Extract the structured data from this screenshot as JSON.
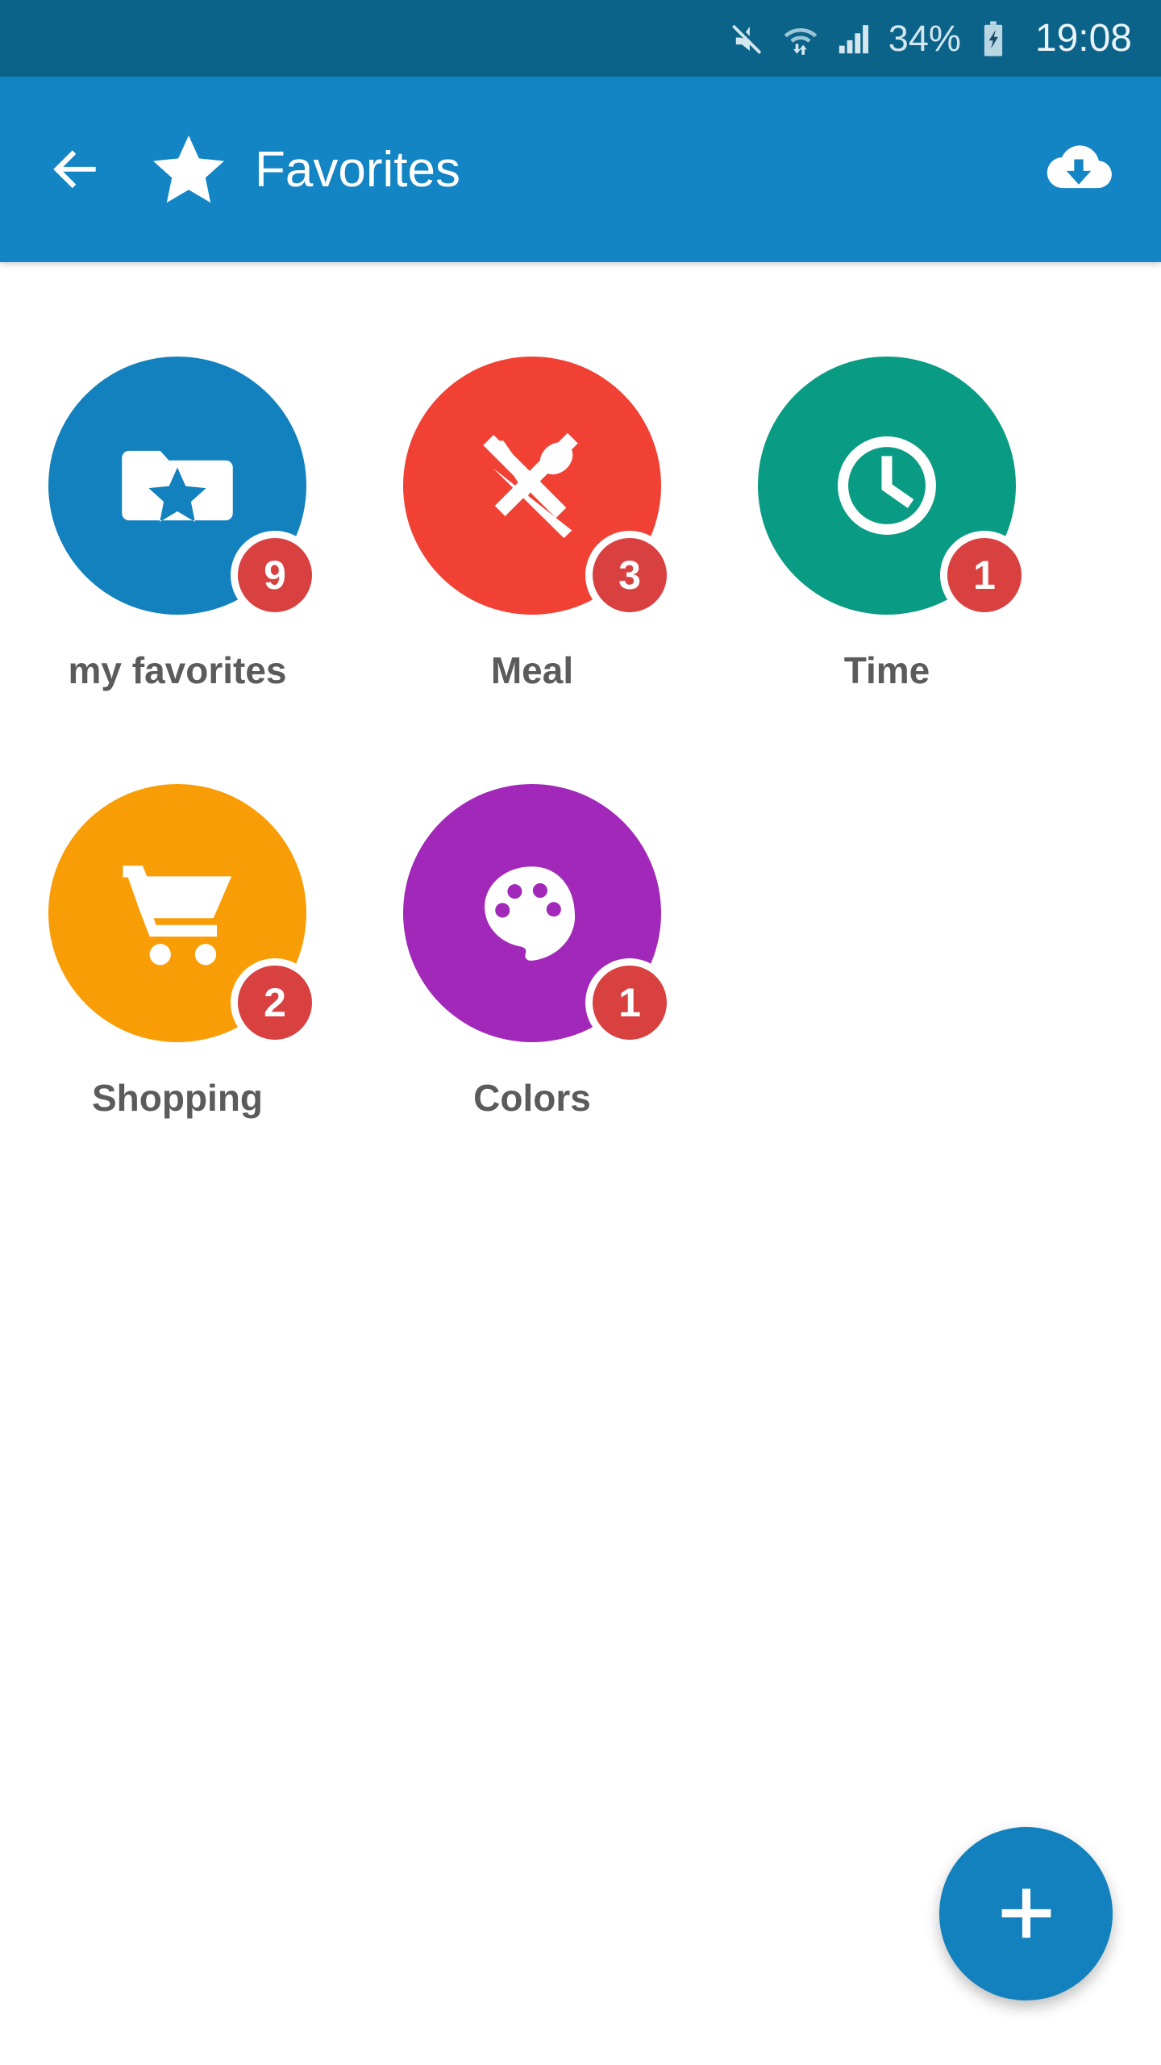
{
  "status_bar": {
    "mute_icon": "mute-icon",
    "wifi_icon": "wifi-transfer-icon",
    "signal_icon": "signal-bars-icon",
    "battery_percent": "34%",
    "battery_icon": "battery-charging-icon",
    "clock": "19:08",
    "background": "#0b6389",
    "foreground": "#d4e6ee"
  },
  "app_bar": {
    "back_icon": "back-arrow-icon",
    "brand_icon": "star-icon",
    "title": "Favorites",
    "action_icon": "cloud-download-icon",
    "background": "#1385c4",
    "foreground": "#ffffff"
  },
  "grid": {
    "items": [
      {
        "label": "my favorites",
        "badge": "9",
        "color": "#1281be",
        "icon": "folder-star-icon"
      },
      {
        "label": "Meal",
        "badge": "3",
        "color": "#f04134",
        "icon": "knife-spoon-icon"
      },
      {
        "label": "Time",
        "badge": "1",
        "color": "#0a9b84",
        "icon": "clock-icon"
      },
      {
        "label": "Shopping",
        "badge": "2",
        "color": "#f99d07",
        "icon": "shopping-cart-icon"
      },
      {
        "label": "Colors",
        "badge": "1",
        "color": "#a128b8",
        "icon": "palette-icon"
      }
    ],
    "badge_color": "#d94040",
    "label_color": "#5b5b5b"
  },
  "fab": {
    "icon": "plus-icon",
    "label": "+",
    "color": "#1281be"
  }
}
